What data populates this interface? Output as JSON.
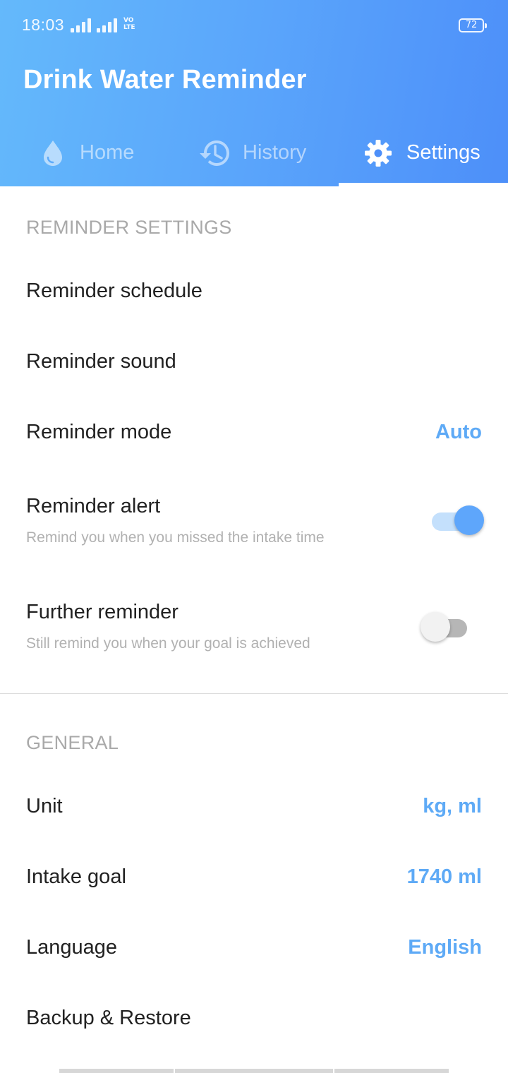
{
  "status_bar": {
    "time": "18:03",
    "volte_line1": "VO",
    "volte_line2": "LTE",
    "battery": "72"
  },
  "app": {
    "title": "Drink Water Reminder"
  },
  "tabs": [
    {
      "label": "Home",
      "icon": "water-drop-icon",
      "selected": false
    },
    {
      "label": "History",
      "icon": "history-icon",
      "selected": false
    },
    {
      "label": "Settings",
      "icon": "gear-icon",
      "selected": true
    }
  ],
  "reminder_settings": {
    "header": "REMINDER SETTINGS",
    "schedule": {
      "title": "Reminder schedule"
    },
    "sound": {
      "title": "Reminder sound"
    },
    "mode": {
      "title": "Reminder mode",
      "value": "Auto"
    },
    "alert": {
      "title": "Reminder alert",
      "subtitle": "Remind you when you missed the intake time",
      "enabled": true
    },
    "further": {
      "title": "Further reminder",
      "subtitle": "Still remind you when your goal is achieved",
      "enabled": false
    }
  },
  "general": {
    "header": "GENERAL",
    "unit": {
      "title": "Unit",
      "value": "kg, ml"
    },
    "intake_goal": {
      "title": "Intake goal",
      "value": "1740 ml"
    },
    "language": {
      "title": "Language",
      "value": "English"
    },
    "backup": {
      "title": "Backup & Restore"
    }
  },
  "colors": {
    "header_gradient_start": "#64b9fb",
    "header_gradient_end": "#4d8ff9",
    "accent_value": "#5eaaf6",
    "switch_on": "#5ea6fb",
    "section_header": "#a9a9a9"
  }
}
